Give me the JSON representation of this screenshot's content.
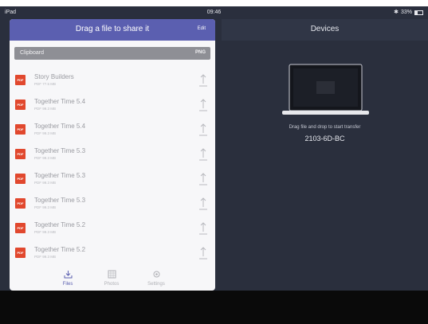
{
  "statusbar": {
    "device": "iPad",
    "time": "09:46",
    "battery": "33%"
  },
  "left_panel": {
    "title": "Drag a file to share it",
    "edit_label": "Edit",
    "clipboard": {
      "label": "Clipboard",
      "format": "PNG"
    },
    "files": [
      {
        "name": "Story Builders",
        "meta": "PDF 77.5 MB",
        "badge": "PDF"
      },
      {
        "name": "Together Time 5.4",
        "meta": "PDF 99.3 MB",
        "badge": "PDF"
      },
      {
        "name": "Together Time 5.4",
        "meta": "PDF 99.3 MB",
        "badge": "PDF"
      },
      {
        "name": "Together Time 5.3",
        "meta": "PDF 99.3 MB",
        "badge": "PDF"
      },
      {
        "name": "Together Time 5.3",
        "meta": "PDF 99.3 MB",
        "badge": "PDF"
      },
      {
        "name": "Together Time 5.3",
        "meta": "PDF 99.3 MB",
        "badge": "PDF"
      },
      {
        "name": "Together Time 5.2",
        "meta": "PDF 99.3 MB",
        "badge": "PDF"
      },
      {
        "name": "Together Time 5.2",
        "meta": "PDF 99.3 MB",
        "badge": "PDF"
      }
    ],
    "tabs": [
      {
        "label": "Files",
        "icon": "download-icon",
        "active": true
      },
      {
        "label": "Photos",
        "icon": "photos-icon",
        "active": false
      },
      {
        "label": "Settings",
        "icon": "gear-icon",
        "active": false
      }
    ]
  },
  "right_panel": {
    "title": "Devices",
    "hint": "Drag file and drop to start transfer",
    "device_name": "2103-6D-BC"
  },
  "colors": {
    "accent": "#5b5fb0",
    "pdf_badge": "#e1482e",
    "background": "#2a2f3d"
  }
}
